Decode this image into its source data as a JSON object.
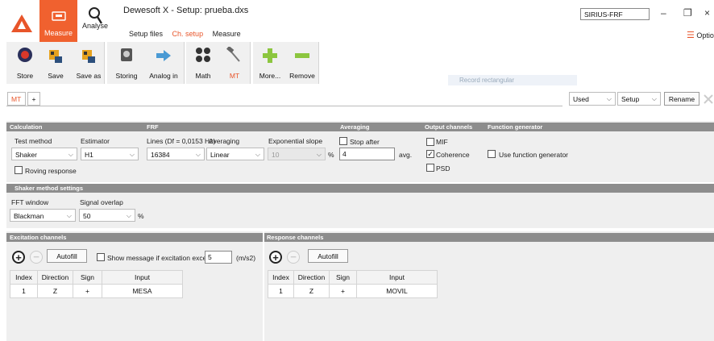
{
  "app": {
    "title": "Dewesoft X - Setup: prueba.dxs",
    "device": "SIRIUS-FRF",
    "options_label": "Optio",
    "modes": [
      {
        "label": "Measure"
      },
      {
        "label": "Analyse"
      }
    ],
    "subtabs": [
      "Setup files",
      "Ch. setup",
      "Measure"
    ],
    "window_controls": {
      "minimize": "–",
      "restore": "❐",
      "close": "×"
    }
  },
  "toolbar": {
    "buttons": [
      {
        "label": "Store"
      },
      {
        "label": "Save"
      },
      {
        "label": "Save as"
      },
      {
        "label": "Storing"
      },
      {
        "label": "Analog in"
      },
      {
        "label": "Math"
      },
      {
        "label": "MT"
      },
      {
        "label": "More..."
      },
      {
        "label": "Remove"
      }
    ],
    "faded_tip": "Record rectangular"
  },
  "tabs": {
    "items": [
      "MT",
      "+"
    ],
    "used_select": "Used",
    "setup_select": "Setup",
    "rename": "Rename"
  },
  "calculation": {
    "header": "Calculation",
    "test_method_label": "Test method",
    "test_method": "Shaker",
    "estimator_label": "Estimator",
    "estimator": "H1",
    "roving_response": "Roving response"
  },
  "frf": {
    "header": "FRF",
    "lines_label": "Lines (Df = 0,0153 Hz)",
    "lines": "16384",
    "averaging_label": "Averaging",
    "averaging": "Linear",
    "exp_slope_label": "Exponential slope",
    "exp_slope": "10",
    "exp_slope_unit": "%"
  },
  "averaging": {
    "header": "Averaging",
    "stop_after": "Stop after",
    "count": "4",
    "unit": "avg."
  },
  "output_channels": {
    "header": "Output channels",
    "items": [
      {
        "label": "MIF",
        "checked": false
      },
      {
        "label": "Coherence",
        "checked": true
      },
      {
        "label": "PSD",
        "checked": false
      }
    ]
  },
  "function_generator": {
    "header": "Function generator",
    "use_label": "Use function generator"
  },
  "shaker": {
    "header": "Shaker method settings",
    "fft_window_label": "FFT window",
    "fft_window": "Blackman",
    "overlap_label": "Signal overlap",
    "overlap": "50",
    "overlap_unit": "%"
  },
  "excitation": {
    "header": "Excitation channels",
    "autofill": "Autofill",
    "show_message": "Show message if excitation exceeds",
    "threshold": "5",
    "threshold_unit": "(m/s2)",
    "columns": [
      "Index",
      "Direction",
      "Sign",
      "Input"
    ],
    "rows": [
      [
        "1",
        "Z",
        "+",
        "MESA"
      ]
    ]
  },
  "response": {
    "header": "Response channels",
    "autofill": "Autofill",
    "columns": [
      "Index",
      "Direction",
      "Sign",
      "Input"
    ],
    "rows": [
      [
        "1",
        "Z",
        "+",
        "MOVIL"
      ]
    ]
  },
  "colors": {
    "accent": "#f0612f",
    "section_bar": "#8d8d8d",
    "panel": "#efefef"
  }
}
